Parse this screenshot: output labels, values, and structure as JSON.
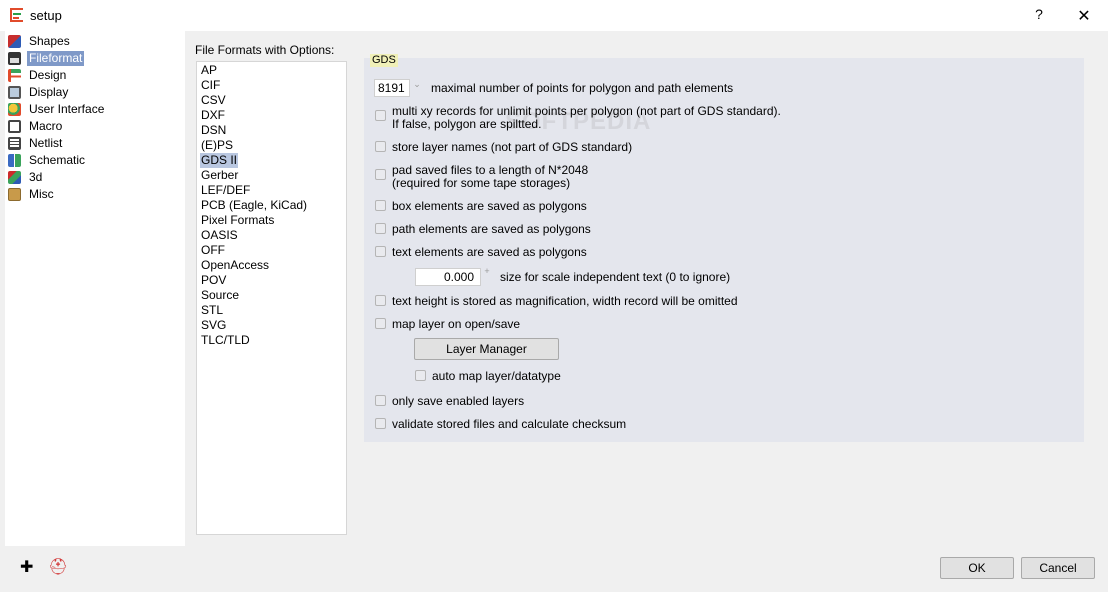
{
  "window": {
    "title": "setup",
    "help_glyph": "?",
    "close_glyph": "✕"
  },
  "sidebar": {
    "items": [
      {
        "label": "Shapes",
        "icon": "shapes-icon",
        "color": "#c62e2e"
      },
      {
        "label": "Fileformat",
        "icon": "floppy-icon",
        "color": "#333333",
        "selected": true
      },
      {
        "label": "Design",
        "icon": "design-icon",
        "color": "#3aa35b"
      },
      {
        "label": "Display",
        "icon": "display-icon",
        "color": "#555555"
      },
      {
        "label": "User Interface",
        "icon": "user-interface-icon",
        "color": "#e0a020"
      },
      {
        "label": "Macro",
        "icon": "macro-icon",
        "color": "#444444"
      },
      {
        "label": "Netlist",
        "icon": "netlist-icon",
        "color": "#444444"
      },
      {
        "label": "Schematic",
        "icon": "schematic-icon",
        "color": "#3a6ac2"
      },
      {
        "label": "3d",
        "icon": "cube-3d-icon",
        "color": "#cc2b2b"
      },
      {
        "label": "Misc",
        "icon": "misc-box-icon",
        "color": "#c89a4a"
      }
    ]
  },
  "formats": {
    "header": "File Formats with Options:",
    "items": [
      "AP",
      "CIF",
      "CSV",
      "DXF",
      "DSN",
      "(E)PS",
      "GDS II",
      "Gerber",
      "LEF/DEF",
      "PCB (Eagle, KiCad)",
      "Pixel Formats",
      "OASIS",
      "OFF",
      "OpenAccess",
      "POV",
      "Source",
      "STL",
      "SVG",
      "TLC/TLD"
    ],
    "selected": "GDS II"
  },
  "gds": {
    "title": "GDS",
    "max_points_value": "8191",
    "max_points_label": "maximal number of points for polygon and path elements",
    "multi_xy_label_1": "multi xy records for unlimit points per polygon (not part of GDS standard).",
    "multi_xy_label_2": "If false, polygon are spiltted.",
    "store_layer_names": "store layer names (not part of GDS standard)",
    "pad_saved_1": "pad saved files to a length of N*2048",
    "pad_saved_2": "(required for some tape storages)",
    "box_polygons": "box elements are saved as polygons",
    "path_polygons": "path elements are saved as polygons",
    "text_polygons": "text elements are saved as polygons",
    "text_size_value": "0.000",
    "text_size_label": "size for scale independent text (0 to ignore)",
    "text_height_mag": "text height is stored as magnification, width record will be omitted",
    "map_layer": "map layer on open/save",
    "layer_manager_button": "Layer Manager",
    "auto_map": "auto map layer/datatype",
    "only_enabled": "only save enabled layers",
    "validate": "validate stored files and calculate checksum"
  },
  "footer": {
    "ok": "OK",
    "cancel": "Cancel"
  },
  "watermark": "SOFTPEDIA"
}
